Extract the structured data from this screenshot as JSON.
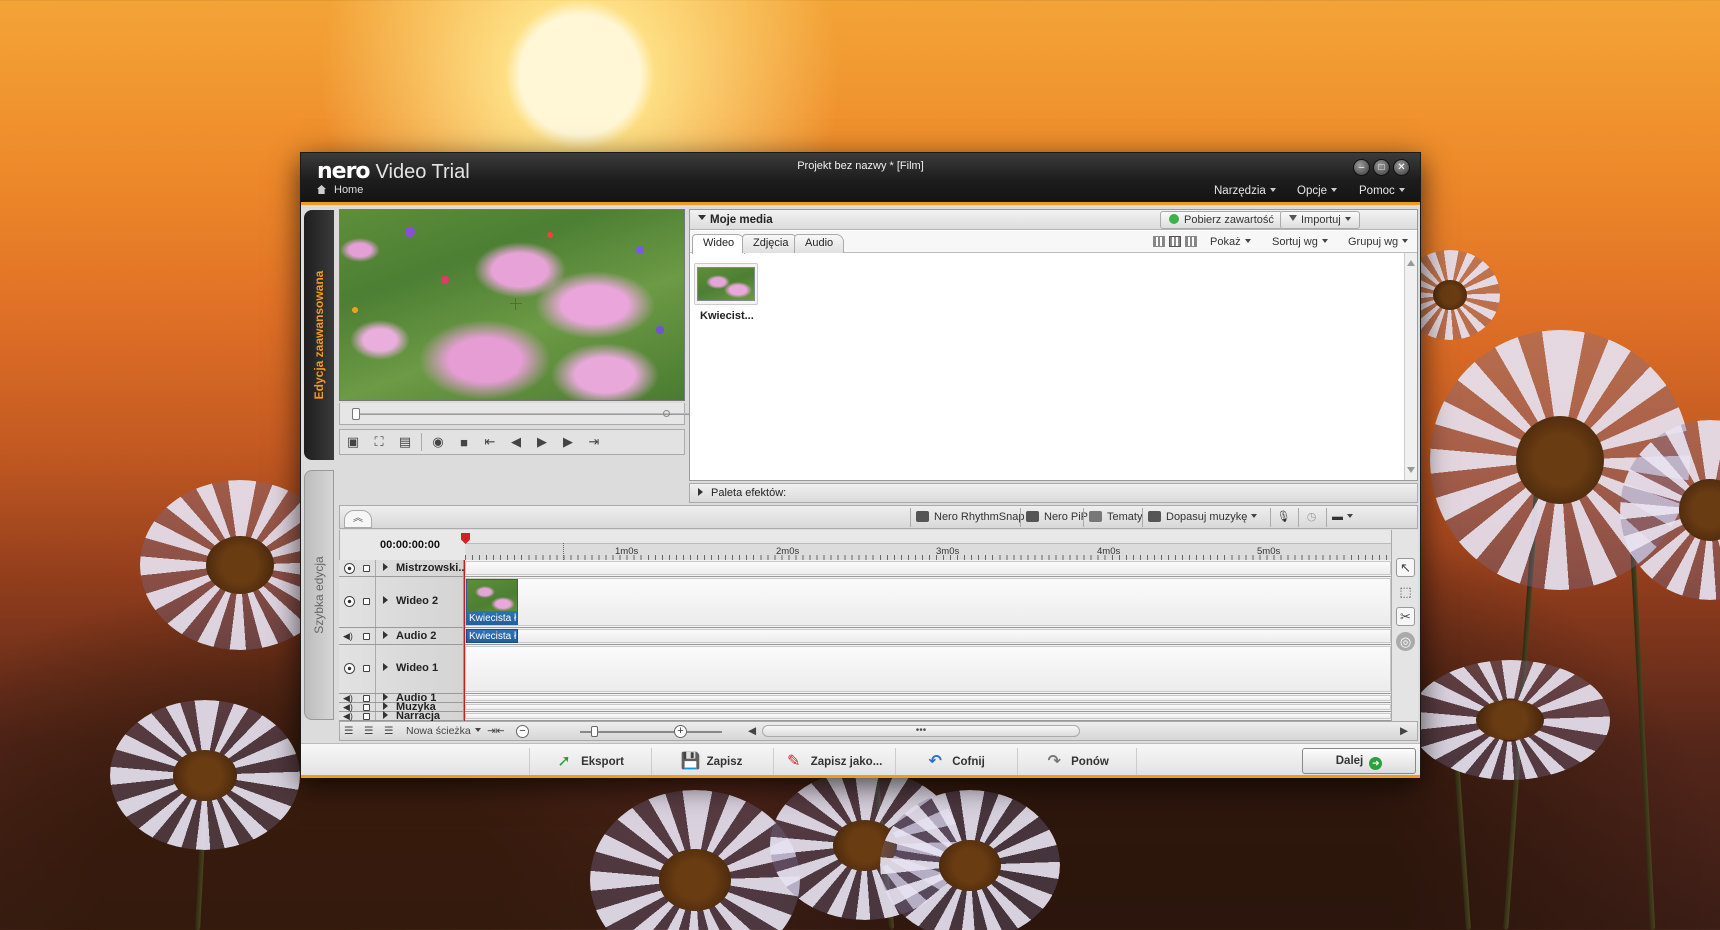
{
  "window": {
    "logo": "nero",
    "product": "Video Trial",
    "title": "Projekt bez nazwy * [Film]",
    "home_label": "Home",
    "menus": [
      "Narzędzia",
      "Opcje",
      "Pomoc"
    ],
    "controls": {
      "minimize": "–",
      "maximize": "□",
      "close": "✕"
    }
  },
  "sidetabs": {
    "advanced": "Edycja zaawansowana",
    "quick": "Szybka edycja"
  },
  "transport": {
    "icons": [
      "monitor-icon",
      "fullscreen-icon",
      "aspect-icon",
      "snapshot-icon",
      "stop-icon",
      "mark-in-icon",
      "prev-frame-icon",
      "play-icon",
      "next-frame-icon",
      "mark-out-icon"
    ],
    "glyphs": [
      "▣",
      "⛶",
      "▤",
      "◉",
      "■",
      "⇤",
      "◀",
      "▶",
      "▶",
      "⇥"
    ]
  },
  "media": {
    "title": "Moje media",
    "download_button": "Pobierz zawartość",
    "import_button": "Importuj",
    "tabs": [
      "Wideo",
      "Zdjęcia",
      "Audio"
    ],
    "active_tab": "Wideo",
    "menus": [
      "Pokaż",
      "Sortuj wg",
      "Grupuj wg"
    ],
    "items": [
      {
        "label": "Kwiecist..."
      }
    ]
  },
  "effects": {
    "label": "Paleta efektów:"
  },
  "timeline_tools": [
    "Nero RhythmSnap",
    "Nero PiP",
    "Tematy",
    "Dopasuj muzykę"
  ],
  "timeline": {
    "timecode": "00:00:00:00",
    "ruler_labels": [
      "1m0s",
      "2m0s",
      "3m0s",
      "4m0s",
      "5m0s"
    ],
    "tracks": [
      {
        "name": "Mistrzowski...",
        "type": "video"
      },
      {
        "name": "Wideo 2",
        "type": "video"
      },
      {
        "name": "Audio 2",
        "type": "audio"
      },
      {
        "name": "Wideo 1",
        "type": "video"
      },
      {
        "name": "Audio 1",
        "type": "audio"
      },
      {
        "name": "Muzyka",
        "type": "audio"
      },
      {
        "name": "Narracja",
        "type": "audio"
      }
    ],
    "clip_video": "Kwiecista ł",
    "clip_audio": "Kwiecista ł",
    "new_track": "Nowa ścieżka",
    "zoom_out": "−",
    "zoom_in": "+",
    "scroll_grip": "•••"
  },
  "footer": {
    "buttons": [
      "Eksport",
      "Zapisz",
      "Zapisz jako...",
      "Cofnij",
      "Ponów"
    ],
    "next": "Dalej",
    "next_glyph": "➜"
  }
}
